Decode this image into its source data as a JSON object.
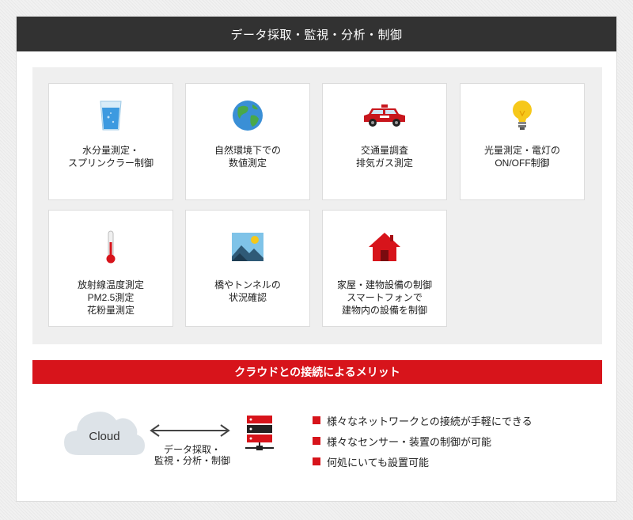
{
  "header": {
    "title": "データ採取・監視・分析・制御"
  },
  "cards": [
    {
      "icon": "water-glass-icon",
      "lines": [
        "水分量測定・",
        "スプリンクラー制御"
      ]
    },
    {
      "icon": "globe-icon",
      "lines": [
        "自然環境下での",
        "数値測定"
      ]
    },
    {
      "icon": "car-icon",
      "lines": [
        "交通量調査",
        "排気ガス測定"
      ]
    },
    {
      "icon": "light-bulb-icon",
      "lines": [
        "光量測定・電灯の",
        "ON/OFF制御"
      ]
    },
    {
      "icon": "thermometer-icon",
      "lines": [
        "放射線温度測定",
        "PM2.5測定",
        "花粉量測定"
      ]
    },
    {
      "icon": "landscape-picture-icon",
      "lines": [
        "橋やトンネルの",
        "状況確認"
      ]
    },
    {
      "icon": "house-icon",
      "lines": [
        "家屋・建物設備の制御",
        "スマートフォンで",
        "建物内の設備を制御"
      ]
    }
  ],
  "merit": {
    "title": "クラウドとの接続によるメリット"
  },
  "diagram": {
    "cloud_label": "Cloud",
    "arrow_label": [
      "データ採取・",
      "監視・分析・制御"
    ]
  },
  "benefits": [
    "様々なネットワークとの接続が手軽にできる",
    "様々なセンサー・装置の制御が可能",
    "何処にいても設置可能"
  ],
  "colors": {
    "accent_red": "#d7141b",
    "header_dark": "#323232"
  }
}
